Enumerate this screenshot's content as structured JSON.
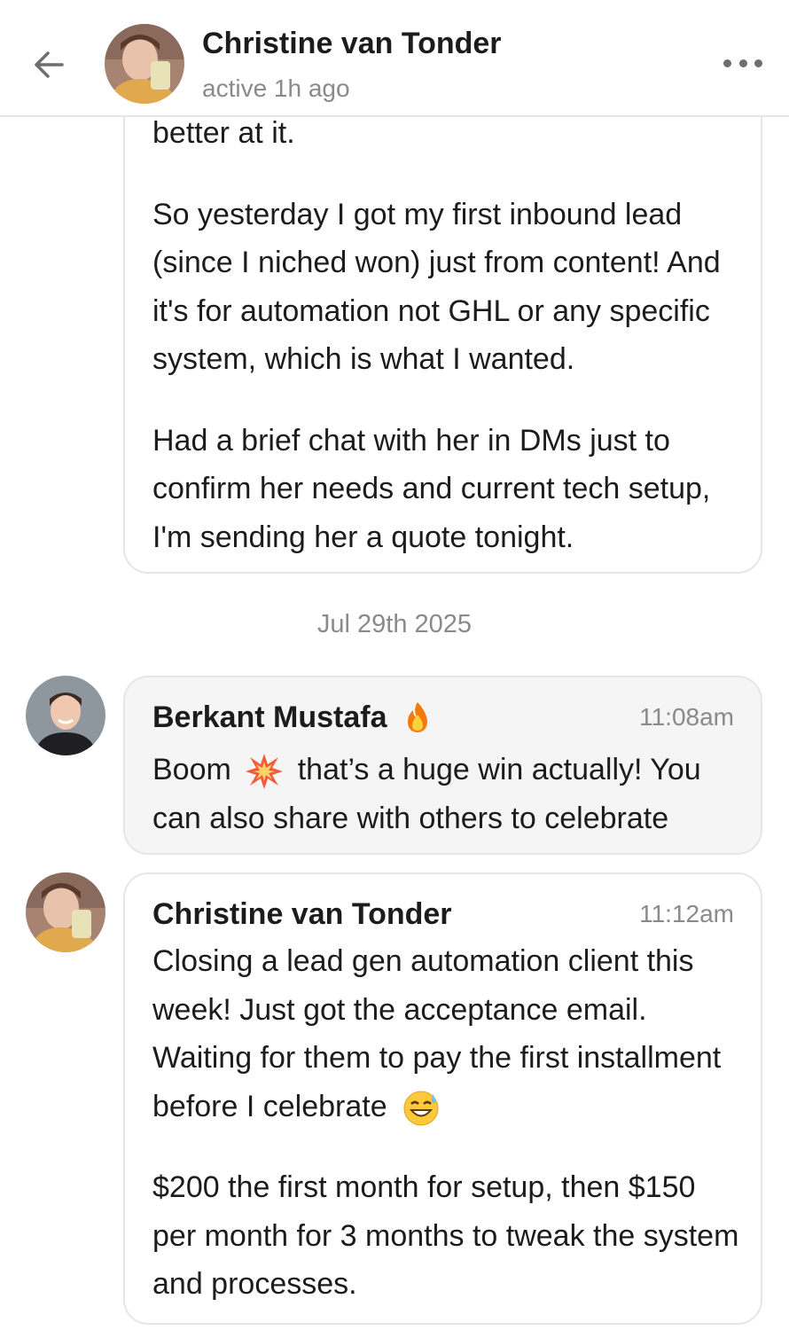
{
  "header": {
    "name": "Christine van Tonder",
    "status": "active 1h ago"
  },
  "messages": [
    {
      "paragraphs": [
        "better at it.",
        "So yesterday I got my first inbound lead (since I niched won) just from content! And it's for automation not GHL or any specific system, which is what I wanted.",
        "Had a brief chat with her in DMs just to confirm her needs and current tech setup, I'm sending her a quote tonight."
      ]
    },
    {
      "author": "Berkant Mustafa",
      "time": "11:08am",
      "text_before": "Boom",
      "text_after": "that’s a huge win actually! You can also share with others to celebrate"
    },
    {
      "author": "Christine van Tonder",
      "time": "11:12am",
      "paragraph1": "Closing a lead gen automation client this week! Just got the acceptance email. Waiting for them to pay the first installment before I celebrate",
      "paragraph2": "$200 the first month for setup, then $150 per month for 3 months to tweak the system and processes."
    }
  ],
  "date_separator": "Jul 29th 2025",
  "icons": {
    "back": "arrow-left-icon",
    "more": "more-dots-icon",
    "fire": "fire-emoji-icon",
    "boom": "collision-emoji-icon",
    "sweat_smile": "sweat-smile-emoji-icon"
  },
  "colors": {
    "border": "#e6e6e6",
    "muted_text": "#8a8a8a",
    "bubble_highlight": "#f5f5f5",
    "text": "#1c1c1c"
  }
}
